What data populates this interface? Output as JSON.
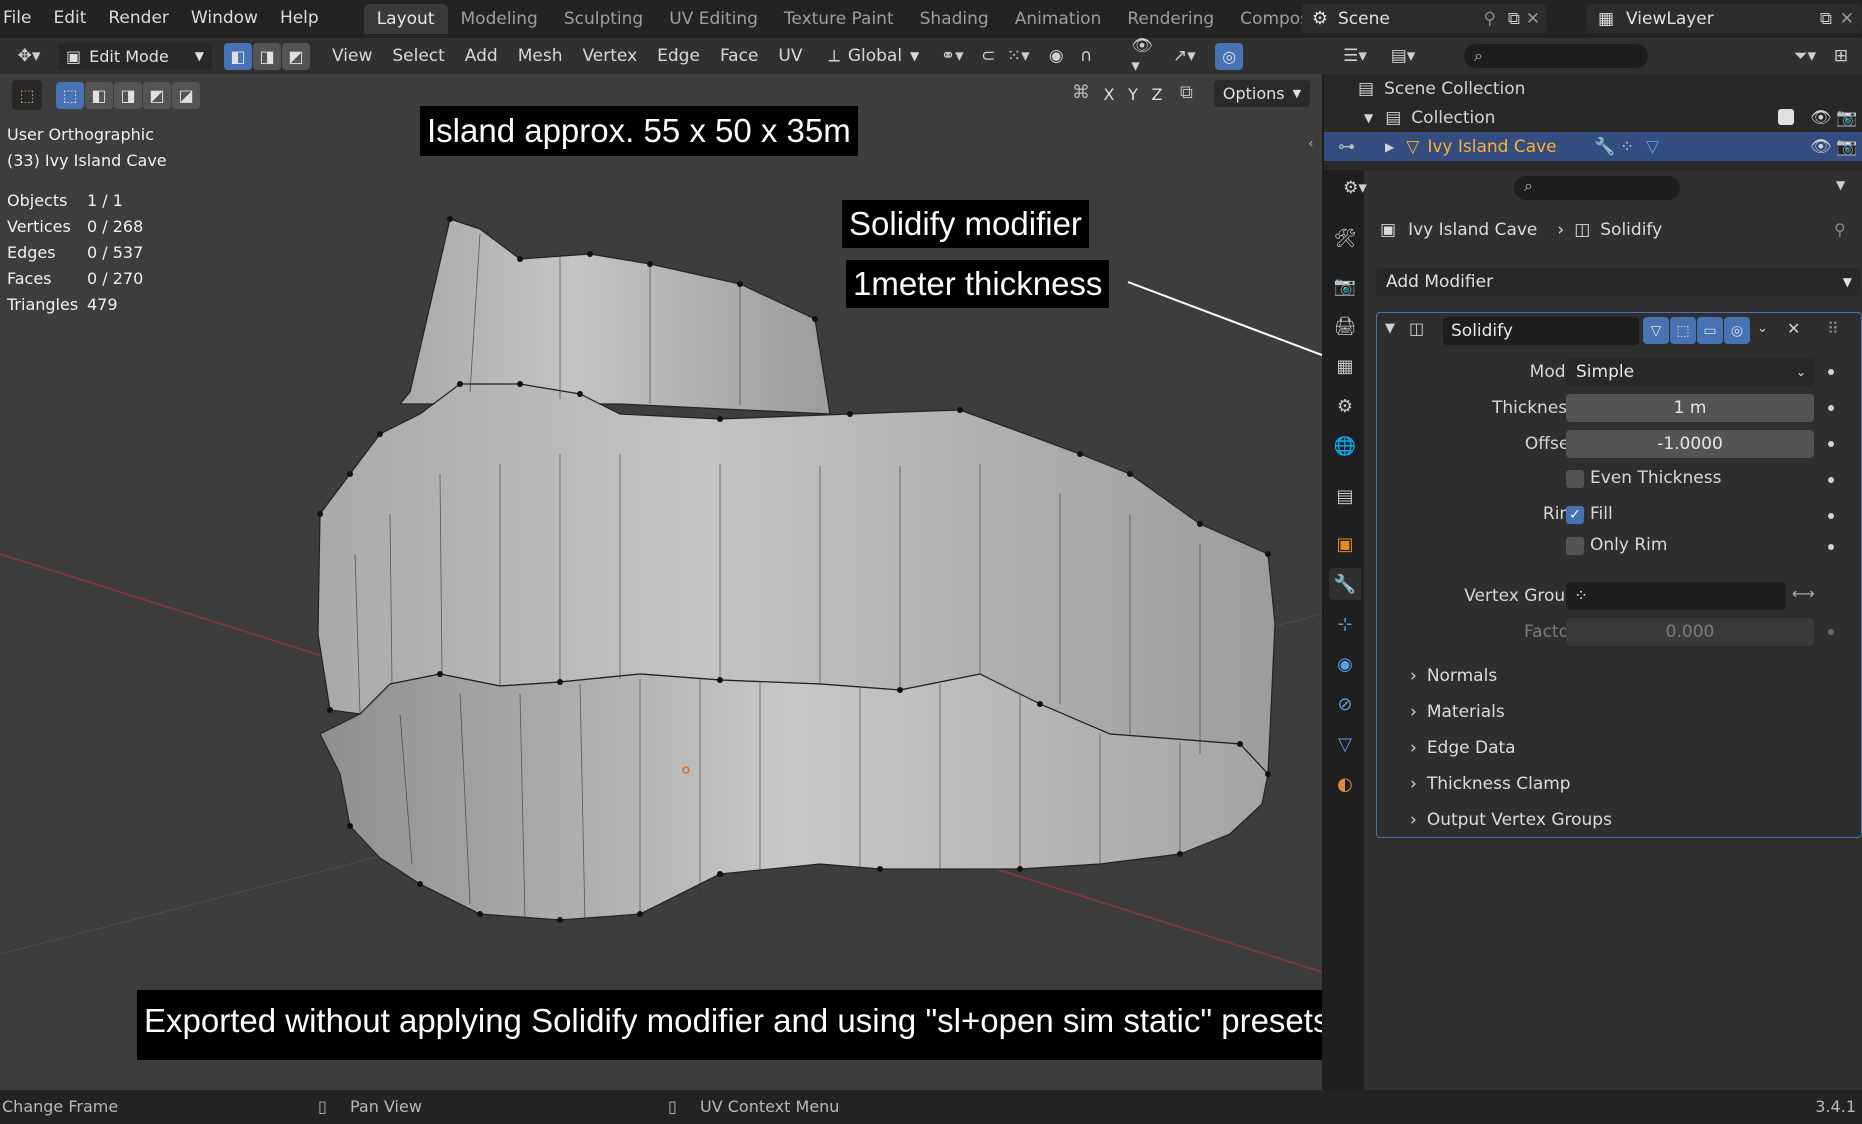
{
  "menubar": {
    "items": [
      "File",
      "Edit",
      "Render",
      "Window",
      "Help"
    ],
    "workspaces": [
      "Layout",
      "Modeling",
      "Sculpting",
      "UV Editing",
      "Texture Paint",
      "Shading",
      "Animation",
      "Rendering",
      "Compositing"
    ],
    "active_workspace": "Layout",
    "scene": "Scene",
    "view_layer": "ViewLayer"
  },
  "viewport_header": {
    "mode": "Edit Mode",
    "menus": [
      "View",
      "Select",
      "Add",
      "Mesh",
      "Vertex",
      "Edge",
      "Face",
      "UV"
    ],
    "orientation": "Global",
    "options": "Options",
    "axes": [
      "X",
      "Y",
      "Z"
    ]
  },
  "viewport": {
    "view_name": "User Orthographic",
    "object_name": "(33) Ivy Island Cave",
    "stats": [
      {
        "label": "Objects",
        "value": "1 / 1"
      },
      {
        "label": "Vertices",
        "value": "0 / 268"
      },
      {
        "label": "Edges",
        "value": "0 / 537"
      },
      {
        "label": "Faces",
        "value": "0 / 270"
      },
      {
        "label": "Triangles",
        "value": "479"
      }
    ],
    "annotations": {
      "size": "Island approx. 55 x 50 x 35m",
      "modifier": "Solidify modifier",
      "thickness": "1meter thickness",
      "export_note": "Exported without applying Solidify modifier and using  \"sl+open sim static\" presets ..............."
    }
  },
  "outliner": {
    "scene_collection": "Scene Collection",
    "collection": "Collection",
    "object": "Ivy Island Cave"
  },
  "properties": {
    "breadcrumb_object": "Ivy Island Cave",
    "breadcrumb_modifier": "Solidify",
    "add_modifier": "Add Modifier",
    "modifier_name": "Solidify",
    "mode_label": "Mode",
    "mode_value": "Simple",
    "thickness_label": "Thickness",
    "thickness_value": "1 m",
    "offset_label": "Offset",
    "offset_value": "-1.0000",
    "even_thickness": "Even Thickness",
    "even_thickness_checked": false,
    "rim_label": "Rim",
    "fill_label": "Fill",
    "fill_checked": true,
    "only_rim": "Only Rim",
    "only_rim_checked": false,
    "vertex_group_label": "Vertex Group",
    "factor_label": "Factor",
    "factor_value": "0.000",
    "subpanels": [
      "Normals",
      "Materials",
      "Edge Data",
      "Thickness Clamp",
      "Output Vertex Groups"
    ]
  },
  "statusbar": {
    "left": "Change Frame",
    "middle1": "Pan View",
    "middle2": "UV Context Menu",
    "version": "3.4.1"
  },
  "colors": {
    "accent": "#4772b3",
    "selection": "#334d80",
    "active_object_text": "#ffaf29",
    "panel_bg": "#303030"
  }
}
